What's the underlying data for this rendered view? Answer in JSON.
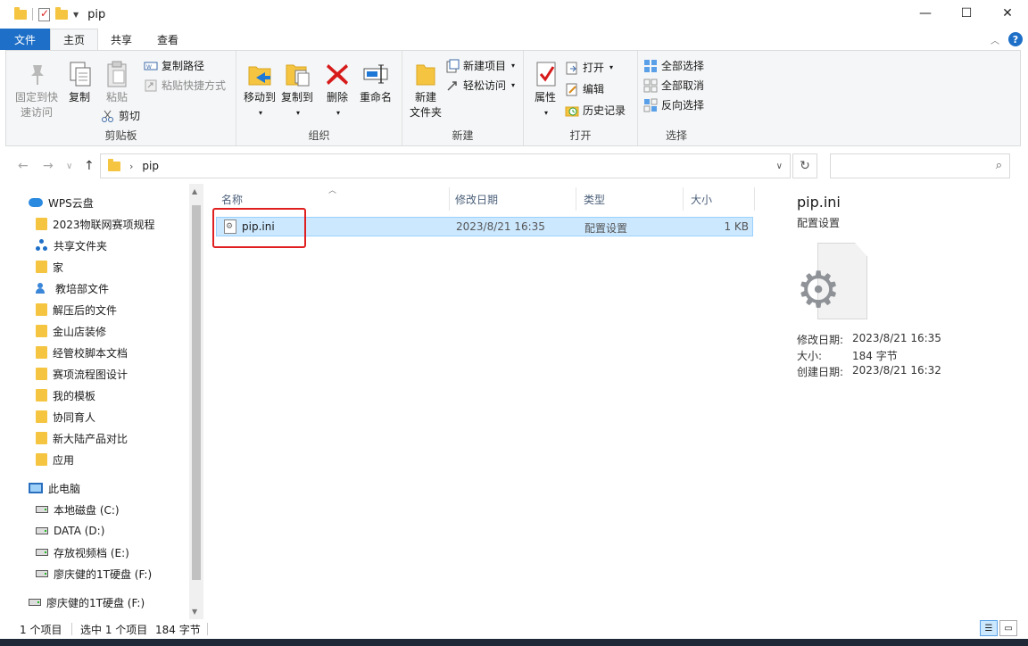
{
  "window": {
    "title": "pip",
    "controls": {
      "minimize": "—",
      "maximize": "☐",
      "close": "✕"
    }
  },
  "ribbon_tabs": [
    {
      "label": "文件"
    },
    {
      "label": "主页"
    },
    {
      "label": "共享"
    },
    {
      "label": "查看"
    }
  ],
  "ribbon": {
    "clipboard": {
      "pin_line1": "固定到快",
      "pin_line2": "速访问",
      "copy": "复制",
      "paste": "粘贴",
      "copy_path": "复制路径",
      "paste_shortcut": "粘贴快捷方式",
      "cut": "剪切",
      "label": "剪贴板"
    },
    "organize": {
      "move_to": "移动到",
      "copy_to": "复制到",
      "delete": "删除",
      "rename": "重命名",
      "label": "组织"
    },
    "new": {
      "new_folder_line1": "新建",
      "new_folder_line2": "文件夹",
      "new_item": "新建项目",
      "easy_access": "轻松访问",
      "label": "新建"
    },
    "open": {
      "properties": "属性",
      "open": "打开",
      "edit": "编辑",
      "history": "历史记录",
      "label": "打开"
    },
    "select": {
      "select_all": "全部选择",
      "select_none": "全部取消",
      "invert": "反向选择",
      "label": "选择"
    }
  },
  "address": {
    "path": "pip",
    "search_placeholder": ""
  },
  "nav_pane": {
    "items": [
      {
        "label": "WPS云盘",
        "icon": "cloud-icon"
      },
      {
        "label": "2023物联网赛项规程",
        "icon": "folder-icon"
      },
      {
        "label": "共享文件夹",
        "icon": "share-icon"
      },
      {
        "label": "家",
        "icon": "folder-icon"
      },
      {
        "label": "教培部文件",
        "icon": "people-icon"
      },
      {
        "label": "解压后的文件",
        "icon": "folder-icon"
      },
      {
        "label": "金山店装修",
        "icon": "folder-icon"
      },
      {
        "label": "经管校脚本文档",
        "icon": "folder-icon"
      },
      {
        "label": "赛项流程图设计",
        "icon": "folder-icon"
      },
      {
        "label": "我的模板",
        "icon": "folder-icon"
      },
      {
        "label": "协同育人",
        "icon": "folder-icon"
      },
      {
        "label": "新大陆产品对比",
        "icon": "folder-icon"
      },
      {
        "label": "应用",
        "icon": "folder-icon"
      },
      {
        "label": "此电脑",
        "icon": "pc-icon"
      },
      {
        "label": "本地磁盘 (C:)",
        "icon": "drive-icon"
      },
      {
        "label": "DATA (D:)",
        "icon": "drive-icon"
      },
      {
        "label": "存放视频档 (E:)",
        "icon": "drive-icon"
      },
      {
        "label": "廖庆健的1T硬盘 (F:)",
        "icon": "drive-icon"
      },
      {
        "label": "廖庆健的1T硬盘 (F:)",
        "icon": "drive-icon"
      }
    ]
  },
  "file_list": {
    "columns": [
      "名称",
      "修改日期",
      "类型",
      "大小"
    ],
    "rows": [
      {
        "name": "pip.ini",
        "modified": "2023/8/21 16:35",
        "type": "配置设置",
        "size": "1 KB"
      }
    ]
  },
  "details": {
    "name": "pip.ini",
    "type": "配置设置",
    "modified_label": "修改日期:",
    "modified": "2023/8/21 16:35",
    "size_label": "大小:",
    "size": "184 字节",
    "created_label": "创建日期:",
    "created": "2023/8/21 16:32"
  },
  "status": {
    "item_count": "1 个项目",
    "selected": "选中 1 个项目",
    "selected_size": "184 字节"
  },
  "colors": {
    "accent": "#1e6fc7",
    "selection": "#cce8ff",
    "highlight_annotation": "#e02020"
  }
}
